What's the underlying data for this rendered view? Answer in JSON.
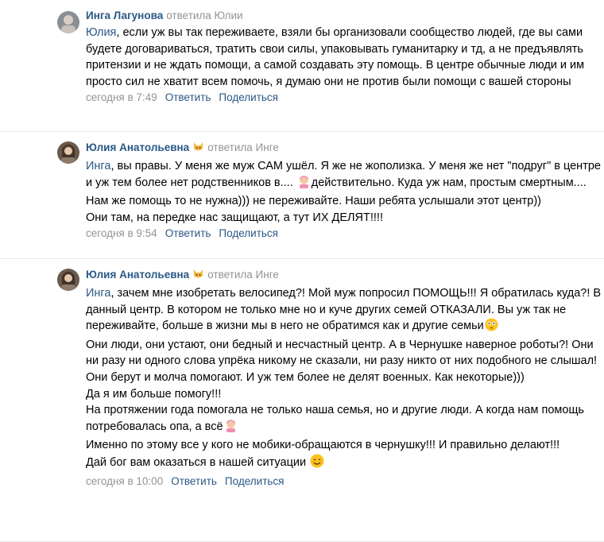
{
  "comments": [
    {
      "author": "Инга Лагунова",
      "replied": "ответила Юлии",
      "mention": "Юлия",
      "text": ", если уж вы так переживаете, взяли бы организовали сообщество людей, где вы сами будете договариваться, тратить свои силы, упаковывать гуманитарку и тд, а не предъявлять притензии и не ждать помощи, а самой создавать эту помощь. В центре обычные люди и им просто сил не хватит всем помочь, я думаю они не против были помощи с вашей стороны",
      "date": "сегодня в 7:49",
      "reply_label": "Ответить",
      "share_label": "Поделиться"
    },
    {
      "author": "Юлия Анатольевна",
      "replied": "ответила Инге",
      "mention": "Инга",
      "text_a": ", вы правы. У меня же муж САМ ушёл. Я же не жополизка. У меня же нет \"подруг\" в центре и уж тем более нет родственников в.... ",
      "text_b": "действительно. Куда уж нам, простым смертным.... Нам же помощь то не нужна))) не переживайте. Наши ребята услышали этот центр))\nОни там, на передке нас защищают, а тут ИХ ДЕЛЯТ!!!!",
      "date": "сегодня в 9:54",
      "reply_label": "Ответить",
      "share_label": "Поделиться"
    },
    {
      "author": "Юлия Анатольевна",
      "replied": "ответила Инге",
      "mention": "Инга",
      "text_a": ", зачем мне изобретать велосипед?! Мой муж попросил ПОМОЩЬ!!! Я обратилась куда?! В данный центр. В котором не только мне но и куче других семей ОТКАЗАЛИ. Вы уж так не переживайте, больше в жизни мы в него не обратимся как и другие семьи",
      "text_b": "\nОни люди, они устают, они бедный и несчастный центр. А в Чернушке наверное роботы?! Они ни разу ни одного слова упрёка никому не сказали, ни разу никто от них подобного не слышал! Они берут и молча помогают. И уж тем более не делят военных. Как некоторые)))\nДа       я им больше помогу!!!\nНа протяжении года помогала не только наша семья, но и другие люди. А когда нам помощь потребовалась опа, а всё",
      "text_c": "\nИменно по этому все у кого не мобики-обращаются в чернушку!!! И правильно делают!!!\nДай бог вам оказаться в нашей ситуации ",
      "date": "сегодня в 10:00",
      "reply_label": "Ответить",
      "share_label": "Поделиться"
    }
  ],
  "icons": {
    "avatar1": "profile-photo-icon",
    "avatar2": "profile-photo-icon",
    "badge": "cat-face-icon",
    "emoji_raising_hand": "person-raising-hand-icon",
    "emoji_flushed": "flushed-face-icon",
    "emoji_smile": "smiling-face-icon"
  },
  "colors": {
    "link": "#2a5885",
    "meta": "#939393",
    "divider": "#e7e8ec"
  }
}
